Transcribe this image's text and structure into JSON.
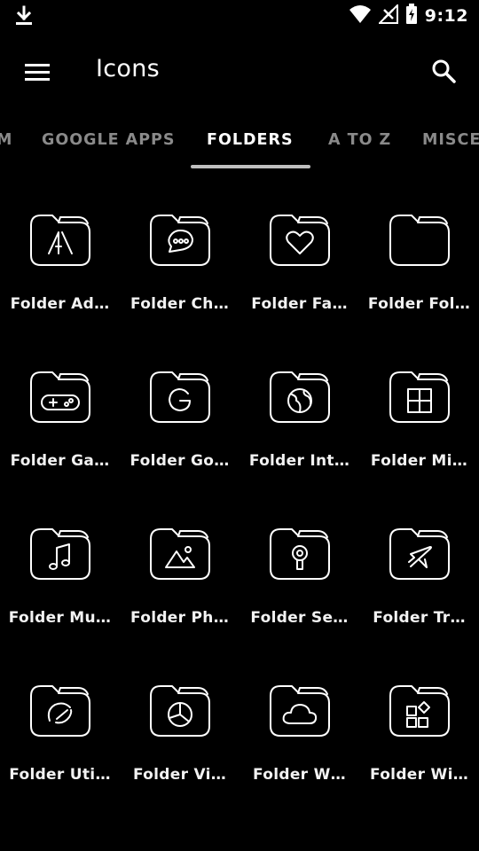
{
  "status_bar": {
    "time": "9:12"
  },
  "app_bar": {
    "title": "Icons"
  },
  "tabs": [
    {
      "label": "M"
    },
    {
      "label": "GOOGLE APPS"
    },
    {
      "label": "FOLDERS"
    },
    {
      "label": "A TO Z"
    },
    {
      "label": "MISCE"
    }
  ],
  "active_tab": "FOLDERS",
  "icons": [
    {
      "label": "Folder Ad…",
      "glyph": "adobe-icon"
    },
    {
      "label": "Folder Ch…",
      "glyph": "chat-icon"
    },
    {
      "label": "Folder Fa…",
      "glyph": "heart-icon"
    },
    {
      "label": "Folder Fol…",
      "glyph": "folder-icon"
    },
    {
      "label": "Folder Ga…",
      "glyph": "gamepad-icon"
    },
    {
      "label": "Folder Go…",
      "glyph": "google-icon"
    },
    {
      "label": "Folder Int…",
      "glyph": "globe-icon"
    },
    {
      "label": "Folder Mi…",
      "glyph": "microsoft-icon"
    },
    {
      "label": "Folder Mu…",
      "glyph": "music-icon"
    },
    {
      "label": "Folder Ph…",
      "glyph": "photo-icon"
    },
    {
      "label": "Folder Se…",
      "glyph": "keyhole-icon"
    },
    {
      "label": "Folder Tr…",
      "glyph": "airplane-icon"
    },
    {
      "label": "Folder Uti…",
      "glyph": "gauge-icon"
    },
    {
      "label": "Folder Vi…",
      "glyph": "video-icon"
    },
    {
      "label": "Folder W…",
      "glyph": "cloud-icon"
    },
    {
      "label": "Folder Wi…",
      "glyph": "widgets-icon"
    }
  ],
  "colors": {
    "background": "#000000",
    "text": "#ffffff",
    "tab_inactive": "#8a8a8a",
    "indicator": "#bfbfbf"
  }
}
